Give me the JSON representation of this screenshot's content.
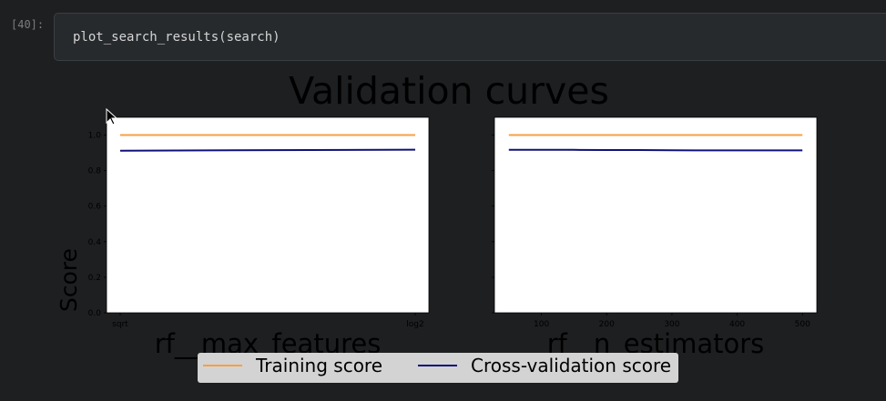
{
  "cell": {
    "prompt": "[40]:",
    "code": "plot_search_results(search)"
  },
  "colors": {
    "training": "#f7a040",
    "cv": "#10107a",
    "page_bg": "#1d1f21",
    "cell_bg": "#272a2d",
    "plot_bg": "#ffffff",
    "legend_bg": "#d3d3d3"
  },
  "chart_data": {
    "type": "line",
    "title": "Validation curves",
    "ylabel": "Score",
    "legend": {
      "position": "bottom-center",
      "entries": [
        "Training score",
        "Cross-validation score"
      ]
    },
    "subplots": [
      {
        "xlabel": "rf__max_features",
        "x_categories": [
          "sqrt",
          "log2"
        ],
        "ylim": [
          0.0,
          1.1
        ],
        "y_ticks": [
          "0.0",
          "0.2",
          "0.4",
          "0.6",
          "0.8",
          "1.0"
        ],
        "series": [
          {
            "name": "Training score",
            "values": [
              1.0,
              1.0
            ]
          },
          {
            "name": "Cross-validation score",
            "values": [
              0.912,
              0.918
            ]
          }
        ]
      },
      {
        "xlabel": "rf__n_estimators",
        "xlim": [
          28,
          522
        ],
        "x_ticks": [
          "100",
          "200",
          "300",
          "400",
          "500"
        ],
        "ylim": [
          0.0,
          1.1
        ],
        "series": [
          {
            "name": "Training score",
            "x": [
              50,
              100,
              150,
              200,
              250,
              300,
              350,
              400,
              450,
              500
            ],
            "values": [
              1.0,
              1.0,
              1.0,
              1.0,
              1.0,
              1.0,
              1.0,
              1.0,
              1.0,
              1.0
            ]
          },
          {
            "name": "Cross-validation score",
            "x": [
              50,
              100,
              150,
              200,
              250,
              300,
              350,
              400,
              450,
              500
            ],
            "values": [
              0.917,
              0.917,
              0.917,
              0.916,
              0.916,
              0.915,
              0.914,
              0.914,
              0.914,
              0.914
            ]
          }
        ]
      }
    ]
  }
}
